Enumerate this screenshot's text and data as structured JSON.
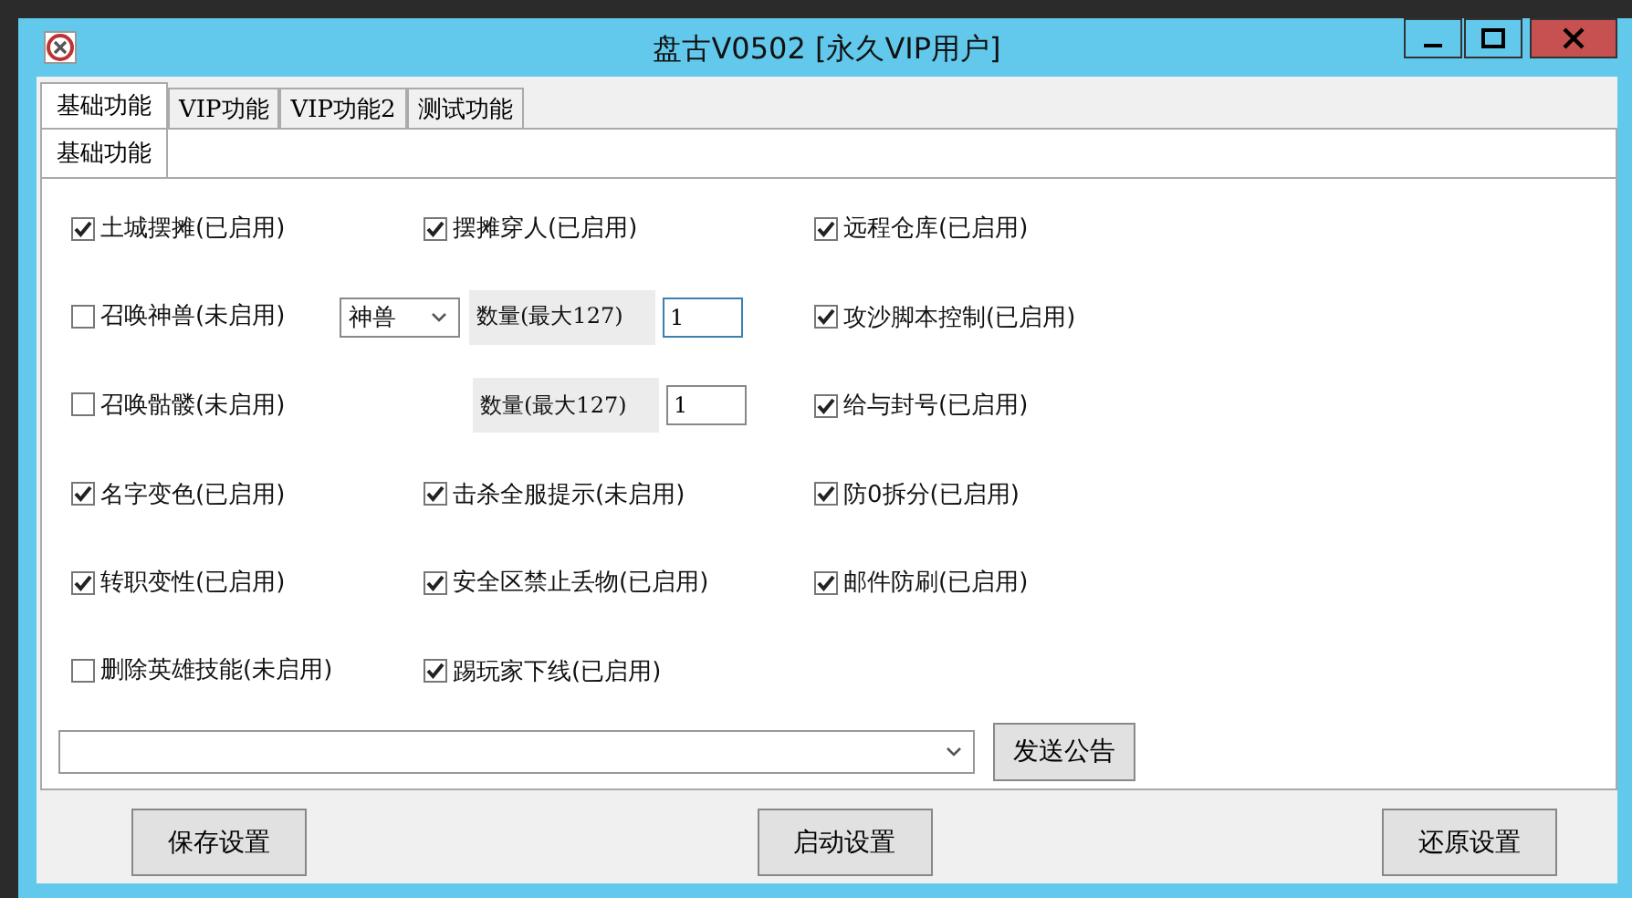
{
  "window": {
    "title": "盘古V0502 [永久VIP用户]"
  },
  "tabs": [
    {
      "label": "基础功能",
      "selected": true
    },
    {
      "label": "VIP功能",
      "selected": false
    },
    {
      "label": "VIP功能2",
      "selected": false
    },
    {
      "label": "测试功能",
      "selected": false
    }
  ],
  "subtabs": [
    {
      "label": "基础功能",
      "selected": true
    }
  ],
  "rows": [
    {
      "left": {
        "label": "土城摆摊(已启用)",
        "checked": true
      },
      "middle": {
        "kind": "checkbox",
        "label": "摆摊穿人(已启用)",
        "checked": true
      },
      "right": {
        "label": "远程仓库(已启用)",
        "checked": true
      }
    },
    {
      "left": {
        "label": "召唤神兽(未启用)",
        "checked": false
      },
      "middle": {
        "kind": "spinner",
        "combo": "神兽",
        "qty_label": "数量(最大127)",
        "value": "1"
      },
      "right": {
        "label": "攻沙脚本控制(已启用)",
        "checked": true
      }
    },
    {
      "left": {
        "label": "召唤骷髅(未启用)",
        "checked": false
      },
      "middle": {
        "kind": "spinner",
        "qty_label": "数量(最大127)",
        "value": "1"
      },
      "right": {
        "label": "给与封号(已启用)",
        "checked": true
      }
    },
    {
      "left": {
        "label": "名字变色(已启用)",
        "checked": true
      },
      "middle": {
        "kind": "checkbox",
        "label": "击杀全服提示(未启用)",
        "checked": true
      },
      "right": {
        "label": "防0拆分(已启用)",
        "checked": true
      }
    },
    {
      "left": {
        "label": "转职变性(已启用)",
        "checked": true
      },
      "middle": {
        "kind": "checkbox",
        "label": "安全区禁止丢物(已启用)",
        "checked": true
      },
      "right": {
        "label": "邮件防刷(已启用)",
        "checked": true
      }
    },
    {
      "left": {
        "label": "删除英雄技能(未启用)",
        "checked": false
      },
      "middle": {
        "kind": "checkbox",
        "label": "踢玩家下线(已启用)",
        "checked": true
      }
    }
  ],
  "announce_button": "发送公告",
  "footer_buttons": [
    "保存设置",
    "启动设置",
    "还原设置"
  ]
}
